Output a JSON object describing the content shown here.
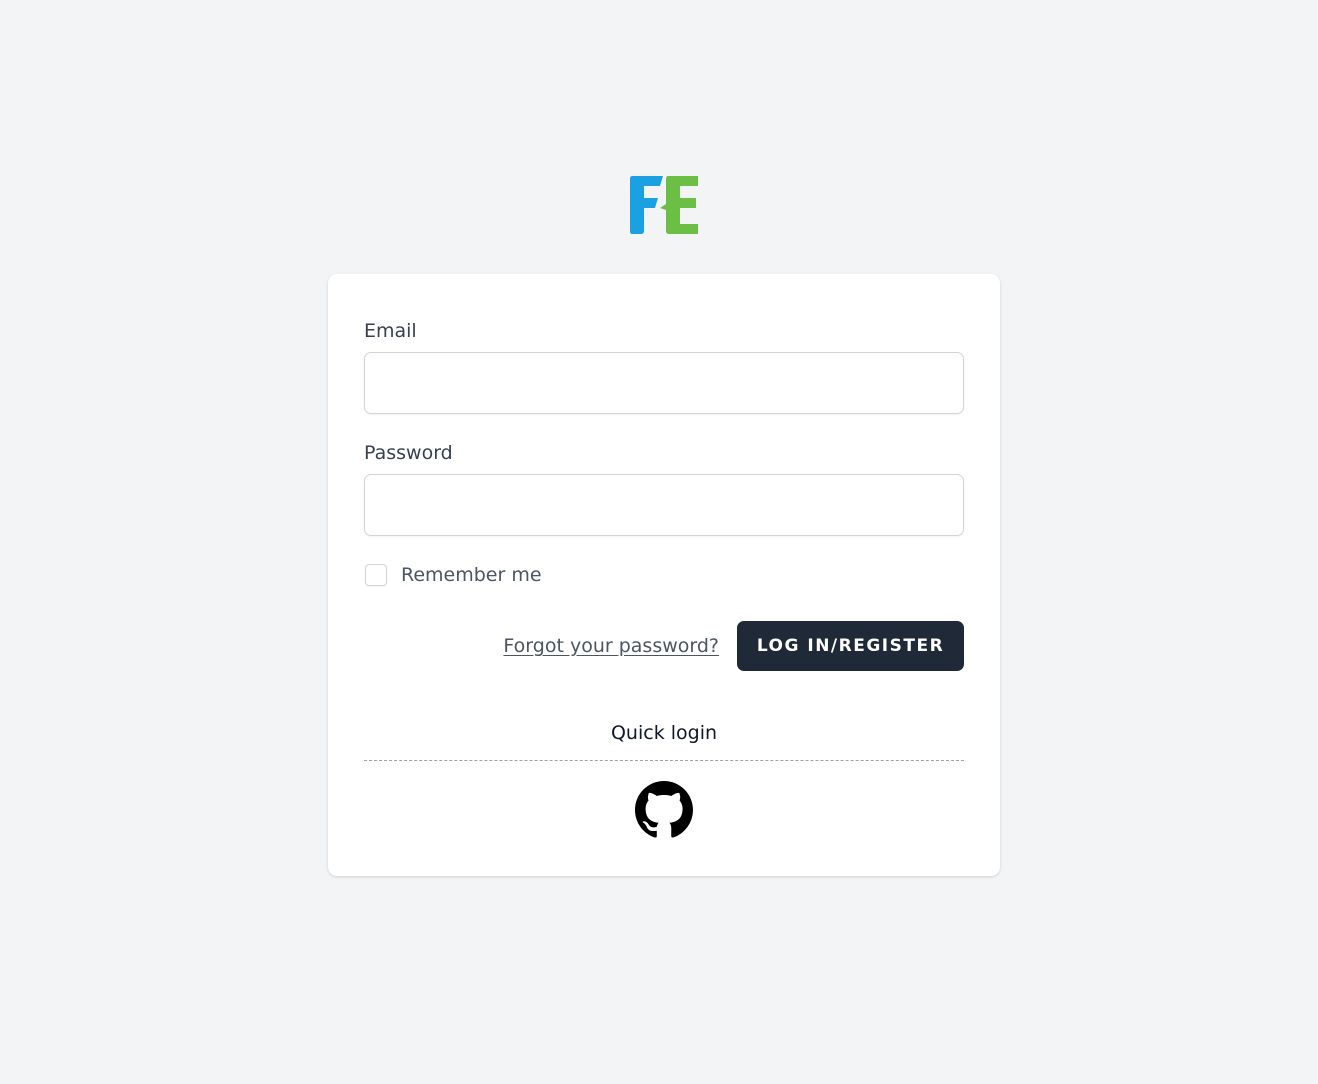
{
  "logo": {
    "icon": "fe-logo-icon",
    "colors": {
      "f": "#1ba1e2",
      "e": "#6cbf45"
    }
  },
  "form": {
    "email_label": "Email",
    "email_value": "",
    "password_label": "Password",
    "password_value": "",
    "remember_label": "Remember me",
    "forgot_link": "Forgot your password?",
    "submit_label": "LOG IN/REGISTER"
  },
  "quick_login": {
    "title": "Quick login",
    "providers": [
      {
        "icon": "github-icon"
      }
    ]
  },
  "colors": {
    "background": "#f3f4f6",
    "card": "#ffffff",
    "button": "#1f2937",
    "button_text": "#ffffff"
  }
}
